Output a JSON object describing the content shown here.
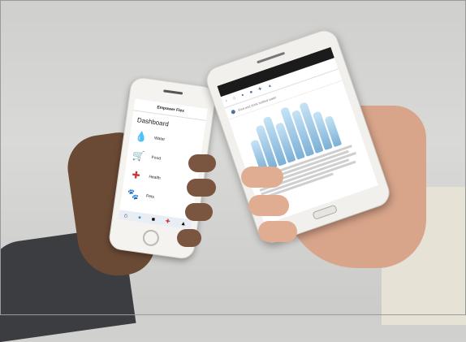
{
  "iphone": {
    "app_title": "Empower Flex",
    "dashboard_label": "Dashboard",
    "items": [
      {
        "name": "Water",
        "icon": "water-drop-icon"
      },
      {
        "name": "Food",
        "icon": "cart-icon"
      },
      {
        "name": "Health",
        "icon": "first-aid-icon"
      },
      {
        "name": "Pets",
        "icon": "pet-carrier-icon"
      }
    ]
  },
  "android": {
    "find_text": "Find and drink bottled water",
    "illustration": "water-bottles-image"
  },
  "colors": {
    "accent": "#4a6fa0",
    "background": "#d4d4d2"
  }
}
